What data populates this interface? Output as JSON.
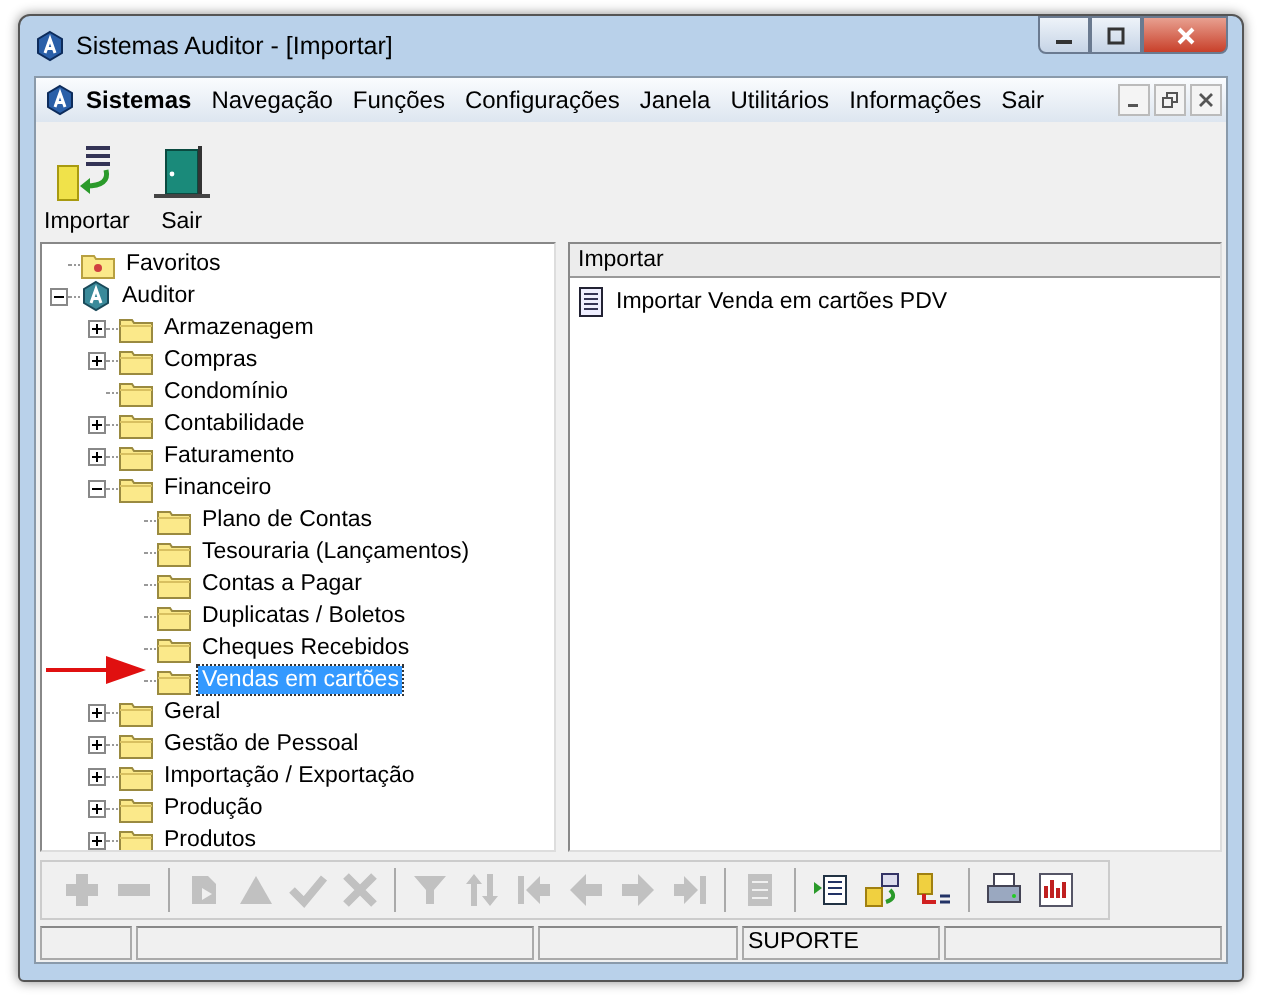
{
  "window": {
    "title": "Sistemas Auditor - [Importar]"
  },
  "menu": {
    "title": "Sistemas",
    "items": [
      "Navegação",
      "Funções",
      "Configurações",
      "Janela",
      "Utilitários",
      "Informações",
      "Sair"
    ]
  },
  "toolbar": [
    {
      "kind": "import",
      "label": "Importar"
    },
    {
      "kind": "exit",
      "label": "Sair"
    }
  ],
  "tree": [
    {
      "label": "Favoritos",
      "kind": "favorites",
      "selected": false
    },
    {
      "label": "Auditor",
      "kind": "root",
      "expanded": true,
      "selected": false,
      "children": [
        {
          "label": "Armazenagem",
          "kind": "folder",
          "expanded": false,
          "selected": false
        },
        {
          "label": "Compras",
          "kind": "folder",
          "expanded": false,
          "selected": false
        },
        {
          "label": "Condomínio",
          "kind": "folder",
          "selected": false
        },
        {
          "label": "Contabilidade",
          "kind": "folder",
          "expanded": false,
          "selected": false
        },
        {
          "label": "Faturamento",
          "kind": "folder",
          "expanded": false,
          "selected": false
        },
        {
          "label": "Financeiro",
          "kind": "folder",
          "expanded": true,
          "selected": false,
          "children": [
            {
              "label": "Plano de Contas",
              "kind": "folder",
              "selected": false
            },
            {
              "label": "Tesouraria (Lançamentos)",
              "kind": "folder",
              "selected": false
            },
            {
              "label": "Contas a Pagar",
              "kind": "folder",
              "selected": false
            },
            {
              "label": "Duplicatas / Boletos",
              "kind": "folder",
              "selected": false
            },
            {
              "label": "Cheques Recebidos",
              "kind": "folder",
              "selected": false
            },
            {
              "label": "Vendas em cartões",
              "kind": "folder",
              "selected": true
            }
          ]
        },
        {
          "label": "Geral",
          "kind": "folder",
          "expanded": false,
          "selected": false
        },
        {
          "label": "Gestão de Pessoal",
          "kind": "folder",
          "expanded": false,
          "selected": false
        },
        {
          "label": "Importação / Exportação",
          "kind": "folder",
          "expanded": false,
          "selected": false
        },
        {
          "label": "Produção",
          "kind": "folder",
          "expanded": false,
          "selected": false
        },
        {
          "label": "Produtos",
          "kind": "folder",
          "expanded": false,
          "selected": false
        }
      ]
    }
  ],
  "list": {
    "header": "Importar",
    "items": [
      "Importar Venda em cartões PDV"
    ]
  },
  "bottom_toolbar": [
    {
      "kind": "add",
      "disabled": true
    },
    {
      "kind": "remove",
      "disabled": true
    },
    {
      "kind": "sep"
    },
    {
      "kind": "refresh",
      "disabled": true
    },
    {
      "kind": "up",
      "disabled": true
    },
    {
      "kind": "confirm",
      "disabled": true
    },
    {
      "kind": "cancel",
      "disabled": true
    },
    {
      "kind": "sep"
    },
    {
      "kind": "filter",
      "disabled": true
    },
    {
      "kind": "sort",
      "disabled": true
    },
    {
      "kind": "first",
      "disabled": true
    },
    {
      "kind": "prev",
      "disabled": true
    },
    {
      "kind": "next",
      "disabled": true
    },
    {
      "kind": "last",
      "disabled": true
    },
    {
      "kind": "sep"
    },
    {
      "kind": "document",
      "disabled": true
    },
    {
      "kind": "sep"
    },
    {
      "kind": "list",
      "disabled": false
    },
    {
      "kind": "database",
      "disabled": false
    },
    {
      "kind": "export",
      "disabled": false
    },
    {
      "kind": "sep"
    },
    {
      "kind": "print",
      "disabled": false
    },
    {
      "kind": "chart",
      "disabled": false
    }
  ],
  "status_bar": {
    "user": "SUPORTE"
  }
}
